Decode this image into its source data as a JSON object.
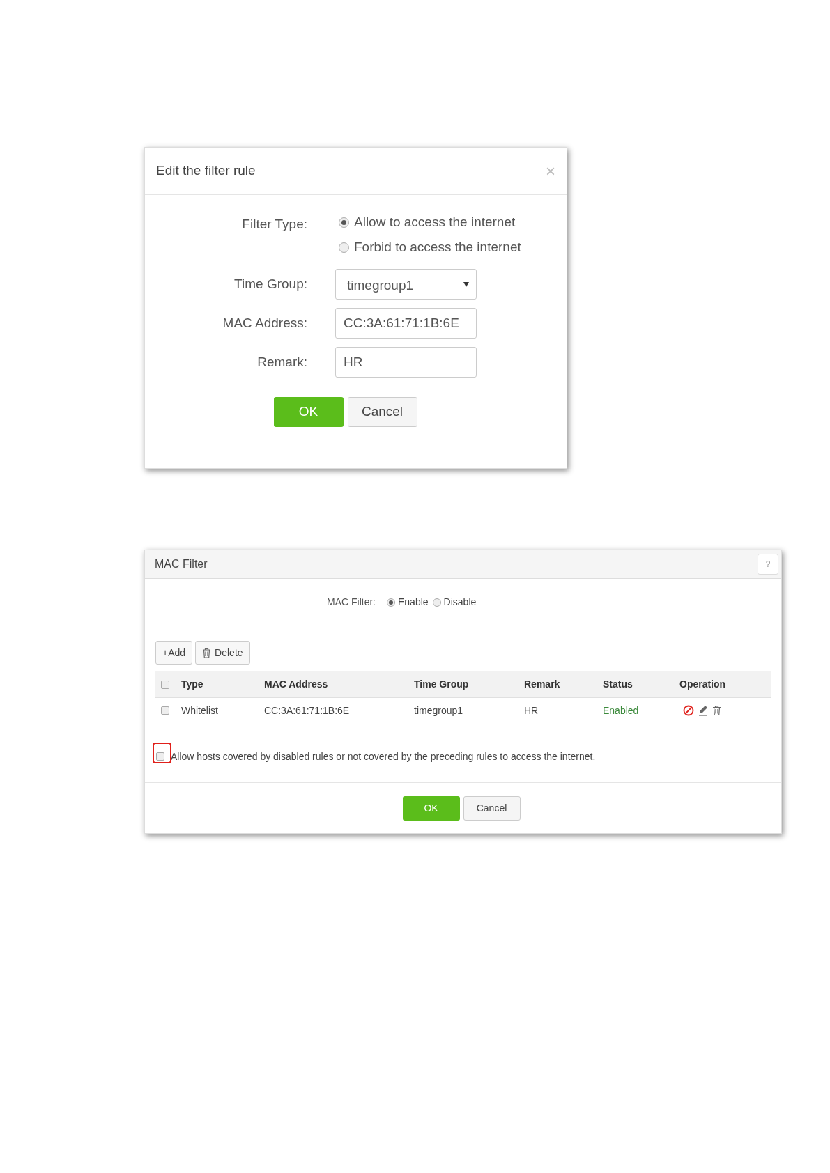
{
  "edit_dialog": {
    "title": "Edit the filter rule",
    "close": "×",
    "filter_type": {
      "label": "Filter Type:",
      "options": [
        {
          "label": "Allow to access the internet",
          "selected": true
        },
        {
          "label": "Forbid to access the internet",
          "selected": false
        }
      ]
    },
    "time_group": {
      "label": "Time Group:",
      "value": "timegroup1"
    },
    "mac_address": {
      "label": "MAC Address:",
      "value": "CC:3A:61:71:1B:6E"
    },
    "remark": {
      "label": "Remark:",
      "value": "HR"
    },
    "buttons": [
      "OK",
      "Cancel"
    ]
  },
  "mac_filter_panel": {
    "title": "MAC Filter",
    "help": "?",
    "mac_filter": {
      "label": "MAC Filter:",
      "options": [
        {
          "label": "Enable",
          "selected": true
        },
        {
          "label": "Disable",
          "selected": false
        }
      ]
    },
    "toolbar": [
      "+Add",
      "Delete"
    ],
    "table": {
      "select_all_checked": false,
      "columns": [
        "Type",
        "MAC Address",
        "Time Group",
        "Remark",
        "Status",
        "Operation"
      ],
      "rows": [
        {
          "checked": false,
          "type": "Whitelist",
          "mac_address": "CC:3A:61:71:1B:6E",
          "time_group": "timegroup1",
          "remark": "HR",
          "status": "Enabled"
        }
      ]
    },
    "allow_hosts": {
      "label": "Allow hosts covered by disabled rules or not covered by the preceding rules to access the internet.",
      "checked": false,
      "highlighted": true
    },
    "buttons": [
      "OK",
      "Cancel"
    ]
  }
}
